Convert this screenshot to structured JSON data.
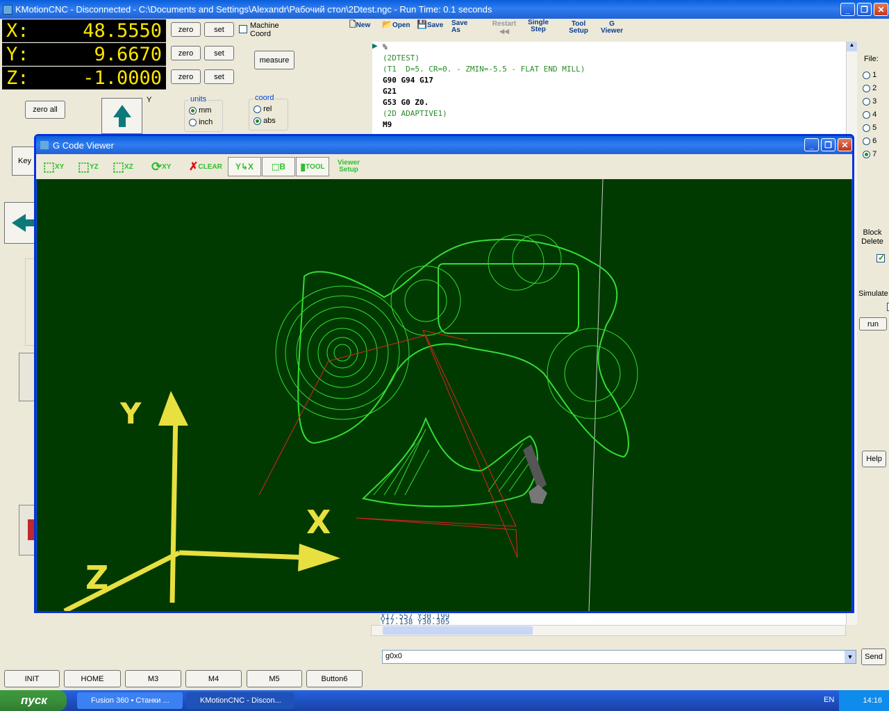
{
  "window": {
    "title": "KMotionCNC - Disconnected - C:\\Documents and Settings\\Alexandr\\Рабочий стол\\2Dtest.ngc  -  Run Time:       0.1 seconds"
  },
  "dro": [
    {
      "axis": "X:",
      "value": "48.5550"
    },
    {
      "axis": "Y:",
      "value": "9.6670"
    },
    {
      "axis": "Z:",
      "value": "-1.0000"
    }
  ],
  "buttons": {
    "zero": "zero",
    "set": "set",
    "zero_all": "zero all",
    "measure": "measure",
    "key_fragment": "Key",
    "run": "run",
    "help": "Help",
    "send": "Send"
  },
  "machine_coord": "Machine\nCoord",
  "units": {
    "title": "units",
    "options": [
      "mm",
      "inch"
    ],
    "selected": "mm"
  },
  "coord": {
    "title": "coord",
    "options": [
      "rel",
      "abs"
    ],
    "selected": "abs"
  },
  "jog_y_label": "Y",
  "toolbar": [
    {
      "label": "New"
    },
    {
      "label": "Open"
    },
    {
      "label": "Save"
    },
    {
      "label": "Save\nAs"
    },
    {
      "label": "Restart"
    },
    {
      "label": "Single\nStep"
    },
    {
      "label": "Tool\nSetup"
    },
    {
      "label": "G\nViewer"
    }
  ],
  "gcode": [
    "%",
    "(2DTEST)",
    "(T1  D=5. CR=0. - ZMIN=-5.5 - FLAT END MILL)",
    "G90 G94 G17",
    "G21",
    "G53 G0 Z0.",
    "(2D ADAPTIVE1)",
    "M9"
  ],
  "gcode_tail": [
    "X17.557 Y30.199",
    "Y17.138 Y30.305"
  ],
  "file_panel": {
    "title": "File:",
    "options": [
      "1",
      "2",
      "3",
      "4",
      "5",
      "6",
      "7"
    ],
    "selected": "7"
  },
  "block_delete": {
    "label": "Block\nDelete",
    "checked": true
  },
  "simulate": {
    "label": "Simulate",
    "checked": false
  },
  "mdi_value": "g0x0",
  "bottom_buttons": [
    "INIT",
    "HOME",
    "M3",
    "M4",
    "M5",
    "Button6"
  ],
  "gviewer": {
    "title": "G Code Viewer",
    "tools": [
      "XY",
      "YZ",
      "XZ",
      "XY",
      "CLEAR",
      "",
      "",
      "TOOL",
      "Viewer\nSetup"
    ],
    "axes": {
      "x": "X",
      "y": "Y",
      "z": "Z"
    }
  },
  "taskbar": {
    "start": "пуск",
    "tasks": [
      "Fusion 360 • Станки ...",
      "KMotionCNC - Discon..."
    ],
    "lang": "EN",
    "clock": "14:16"
  },
  "colors": {
    "dro_bg": "#000000",
    "dro_text": "#FFE600",
    "viewer_bg": "#003A00",
    "toolpath": "#33DD33",
    "rapid": "#DD2222",
    "axes": "#E8E040"
  }
}
